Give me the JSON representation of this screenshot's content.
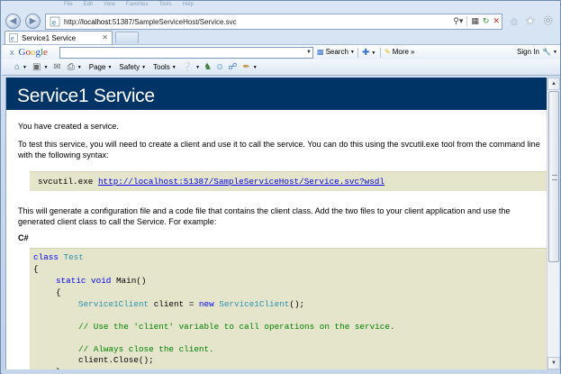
{
  "browser": {
    "menu": [
      "File",
      "Edit",
      "View",
      "Favorites",
      "Tools",
      "Help"
    ],
    "address": {
      "prefix": "http://",
      "host": "localhost",
      "rest": ":51387/SampleServiceHost/Service.svc"
    },
    "tab": {
      "title": "Service1 Service"
    },
    "google_toolbar": {
      "close": "x",
      "logo": [
        "G",
        "o",
        "o",
        "g",
        "l",
        "e"
      ],
      "logo_colors": [
        "#1a56d6",
        "#d62d20",
        "#f2b50f",
        "#1a56d6",
        "#22a048",
        "#d62d20"
      ],
      "search_label": "Search",
      "more_label": "More",
      "signin_label": "Sign In"
    },
    "command_bar": {
      "page_label": "Page",
      "safety_label": "Safety",
      "tools_label": "Tools"
    }
  },
  "page": {
    "title": "Service1 Service",
    "intro": "You have created a service.",
    "instructions": "To test this service, you will need to create a client and use it to call the service. You can do this using the svcutil.exe tool from the command line with the following syntax:",
    "svcutil_cmd": "svcutil.exe ",
    "svcutil_link": "http://localhost:51387/SampleServiceHost/Service.svc?wsdl",
    "generate_text": "This will generate a configuration file and a code file that contains the client class. Add the two files to your client application and use the generated client class to call the Service. For example:",
    "csharp_label": "C#",
    "code": {
      "l1_kw": "class",
      "l1_type": "Test",
      "l2": "{",
      "l3_kw": "static void",
      "l3_rest": " Main()",
      "l4": "{",
      "l5_type": "Service1Client",
      "l5_mid": " client = ",
      "l5_kw": "new",
      "l5_type2": "Service1Client",
      "l5_end": "();",
      "l6_comment": "// Use the 'client' variable to call operations on the service.",
      "l7_comment": "// Always close the client.",
      "l8": "client.Close();",
      "l9": "}"
    }
  }
}
